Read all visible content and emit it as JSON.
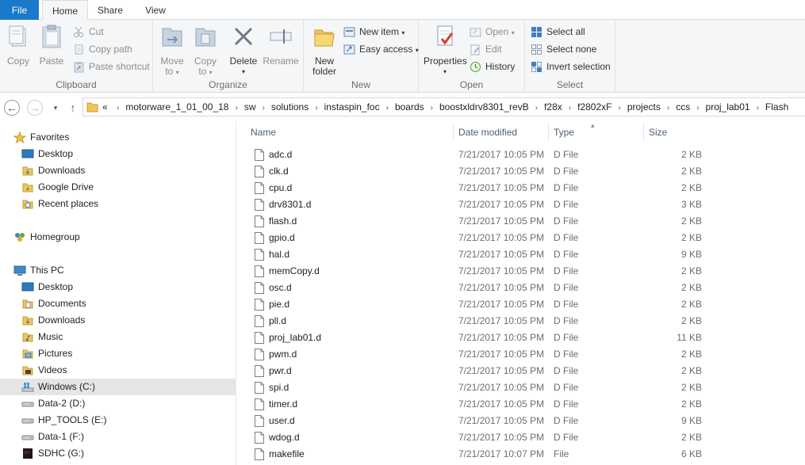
{
  "tabs": {
    "file": "File",
    "home": "Home",
    "share": "Share",
    "view": "View"
  },
  "clipboard": {
    "copy": "Copy",
    "paste": "Paste",
    "cut": "Cut",
    "copy_path": "Copy path",
    "paste_shortcut": "Paste shortcut",
    "label": "Clipboard"
  },
  "organize": {
    "move_to": "Move to",
    "move_to_line1": "Move",
    "move_to_line2": "to",
    "copy_to_line1": "Copy",
    "copy_to_line2": "to",
    "delete": "Delete",
    "rename": "Rename",
    "label": "Organize"
  },
  "new_group": {
    "new_folder_line1": "New",
    "new_folder_line2": "folder",
    "new_item": "New item",
    "easy_access": "Easy access",
    "label": "New"
  },
  "open_group": {
    "properties": "Properties",
    "open": "Open",
    "edit": "Edit",
    "history": "History",
    "label": "Open"
  },
  "select_group": {
    "select_all": "Select all",
    "select_none": "Select none",
    "invert_selection": "Invert selection",
    "label": "Select"
  },
  "address": {
    "overflow": "«",
    "crumbs": [
      "motorware_1_01_00_18",
      "sw",
      "solutions",
      "instaspin_foc",
      "boards",
      "boostxldrv8301_revB",
      "f28x",
      "f2802xF",
      "projects",
      "ccs",
      "proj_lab01",
      "Flash"
    ]
  },
  "nav": {
    "favorites": "Favorites",
    "fav_items": [
      "Desktop",
      "Downloads",
      "Google Drive",
      "Recent places"
    ],
    "homegroup": "Homegroup",
    "this_pc": "This PC",
    "pc_items": [
      "Desktop",
      "Documents",
      "Downloads",
      "Music",
      "Pictures",
      "Videos",
      "Windows (C:)",
      "Data-2 (D:)",
      "HP_TOOLS (E:)",
      "Data-1 (F:)",
      "SDHC (G:)"
    ]
  },
  "columns": {
    "name": "Name",
    "date": "Date modified",
    "type": "Type",
    "size": "Size"
  },
  "files": [
    {
      "name": "adc.d",
      "date": "7/21/2017 10:05 PM",
      "type": "D File",
      "size": "2 KB"
    },
    {
      "name": "clk.d",
      "date": "7/21/2017 10:05 PM",
      "type": "D File",
      "size": "2 KB"
    },
    {
      "name": "cpu.d",
      "date": "7/21/2017 10:05 PM",
      "type": "D File",
      "size": "2 KB"
    },
    {
      "name": "drv8301.d",
      "date": "7/21/2017 10:05 PM",
      "type": "D File",
      "size": "3 KB"
    },
    {
      "name": "flash.d",
      "date": "7/21/2017 10:05 PM",
      "type": "D File",
      "size": "2 KB"
    },
    {
      "name": "gpio.d",
      "date": "7/21/2017 10:05 PM",
      "type": "D File",
      "size": "2 KB"
    },
    {
      "name": "hal.d",
      "date": "7/21/2017 10:05 PM",
      "type": "D File",
      "size": "9 KB"
    },
    {
      "name": "memCopy.d",
      "date": "7/21/2017 10:05 PM",
      "type": "D File",
      "size": "2 KB"
    },
    {
      "name": "osc.d",
      "date": "7/21/2017 10:05 PM",
      "type": "D File",
      "size": "2 KB"
    },
    {
      "name": "pie.d",
      "date": "7/21/2017 10:05 PM",
      "type": "D File",
      "size": "2 KB"
    },
    {
      "name": "pll.d",
      "date": "7/21/2017 10:05 PM",
      "type": "D File",
      "size": "2 KB"
    },
    {
      "name": "proj_lab01.d",
      "date": "7/21/2017 10:05 PM",
      "type": "D File",
      "size": "11 KB"
    },
    {
      "name": "pwm.d",
      "date": "7/21/2017 10:05 PM",
      "type": "D File",
      "size": "2 KB"
    },
    {
      "name": "pwr.d",
      "date": "7/21/2017 10:05 PM",
      "type": "D File",
      "size": "2 KB"
    },
    {
      "name": "spi.d",
      "date": "7/21/2017 10:05 PM",
      "type": "D File",
      "size": "2 KB"
    },
    {
      "name": "timer.d",
      "date": "7/21/2017 10:05 PM",
      "type": "D File",
      "size": "2 KB"
    },
    {
      "name": "user.d",
      "date": "7/21/2017 10:05 PM",
      "type": "D File",
      "size": "9 KB"
    },
    {
      "name": "wdog.d",
      "date": "7/21/2017 10:05 PM",
      "type": "D File",
      "size": "2 KB"
    },
    {
      "name": "makefile",
      "date": "7/21/2017 10:07 PM",
      "type": "File",
      "size": "6 KB"
    }
  ],
  "colors": {
    "file_tab": "#1979ca",
    "selection": "#e5e5e5",
    "header_text": "#4c607a"
  }
}
